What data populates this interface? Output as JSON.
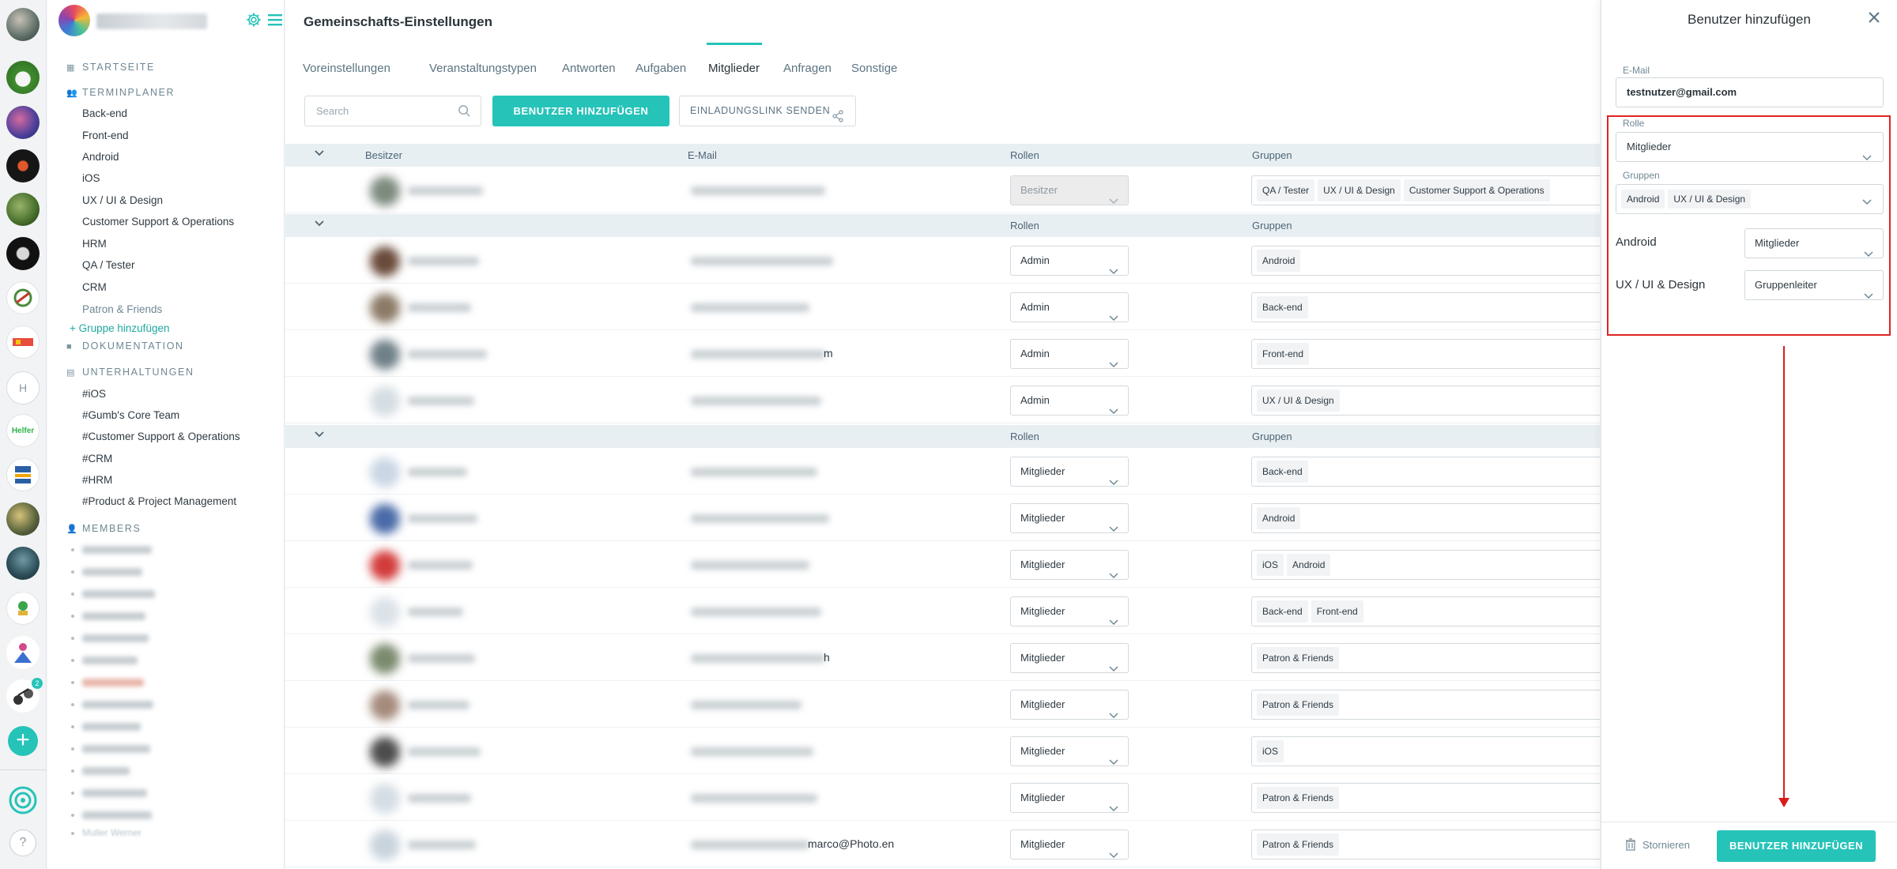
{
  "colors": {
    "accent": "#26c3b9",
    "annotation": "#e02424"
  },
  "sidebar": {
    "sections": {
      "start": "STARTSEITE",
      "planner": "TERMINPLANER",
      "docs": "DOKUMENTATION",
      "chats": "UNTERHALTUNGEN",
      "members": "MEMBERS"
    },
    "planner_items": [
      "Back-end",
      "Front-end",
      "Android",
      "iOS",
      "UX / UI & Design",
      "Customer Support & Operations",
      "HRM",
      "QA / Tester",
      "CRM",
      "Patron & Friends"
    ],
    "add_group": "+ Gruppe hinzufügen",
    "chat_items": [
      "#iOS",
      "#Gumb's Core Team",
      "#Customer Support & Operations",
      "#CRM",
      "#HRM",
      "#Product & Project Management"
    ],
    "members_last": "Muller Werner"
  },
  "rail": {
    "help": "?",
    "badge": "2",
    "h_label": "H",
    "helfer": "Helfer",
    "add": "+"
  },
  "main": {
    "title": "Gemeinschafts-Einstellungen",
    "tabs": [
      "Voreinstellungen",
      "Veranstaltungstypen",
      "Antworten",
      "Aufgaben",
      "Mitglieder",
      "Anfragen",
      "Sonstige"
    ],
    "active_tab": "Mitglieder",
    "search_placeholder": "Search",
    "add_user_button": "BENUTZER HINZUFÜGEN",
    "invite_button": "EINLADUNGSLINK SENDEN",
    "columns": {
      "owner": "Besitzer",
      "email": "E-Mail",
      "roles": "Rollen",
      "groups": "Gruppen"
    },
    "owner_row": {
      "role": "Besitzer",
      "groups": [
        "QA / Tester",
        "UX / UI & Design",
        "Customer Support & Operations"
      ]
    },
    "admin_rows": [
      {
        "role": "Admin",
        "groups": [
          "Android"
        ],
        "email_tail": ""
      },
      {
        "role": "Admin",
        "groups": [
          "Back-end"
        ],
        "email_tail": ""
      },
      {
        "role": "Admin",
        "groups": [
          "Front-end"
        ],
        "email_tail": "m"
      },
      {
        "role": "Admin",
        "groups": [
          "UX / UI & Design"
        ],
        "email_tail": ""
      }
    ],
    "member_rows": [
      {
        "role": "Mitglieder",
        "groups": [
          "Back-end"
        ],
        "email_tail": ""
      },
      {
        "role": "Mitglieder",
        "groups": [
          "Android"
        ],
        "email_tail": ""
      },
      {
        "role": "Mitglieder",
        "groups": [
          "iOS",
          "Android"
        ],
        "email_tail": ""
      },
      {
        "role": "Mitglieder",
        "groups": [
          "Back-end",
          "Front-end"
        ],
        "email_tail": ""
      },
      {
        "role": "Mitglieder",
        "groups": [
          "Patron & Friends"
        ],
        "email_tail": "h"
      },
      {
        "role": "Mitglieder",
        "groups": [
          "Patron & Friends"
        ],
        "email_tail": ""
      },
      {
        "role": "Mitglieder",
        "groups": [
          "iOS"
        ],
        "email_tail": ""
      },
      {
        "role": "Mitglieder",
        "groups": [
          "Patron & Friends"
        ],
        "email_tail": ""
      },
      {
        "role": "Mitglieder",
        "groups": [
          "Patron & Friends"
        ],
        "email_tail": "marco@Photo.en"
      }
    ]
  },
  "panel": {
    "title": "Benutzer hinzufügen",
    "email_label": "E-Mail",
    "email_value": "testnutzer@gmail.com",
    "role_label": "Rolle",
    "role_value": "Mitglieder",
    "groups_label": "Gruppen",
    "groups_selected": [
      "Android",
      "UX / UI & Design"
    ],
    "group_roles": [
      {
        "group": "Android",
        "role": "Mitglieder"
      },
      {
        "group": "UX / UI & Design",
        "role": "Gruppenleiter"
      }
    ],
    "cancel": "Stornieren",
    "submit": "BENUTZER HINZUFÜGEN"
  }
}
